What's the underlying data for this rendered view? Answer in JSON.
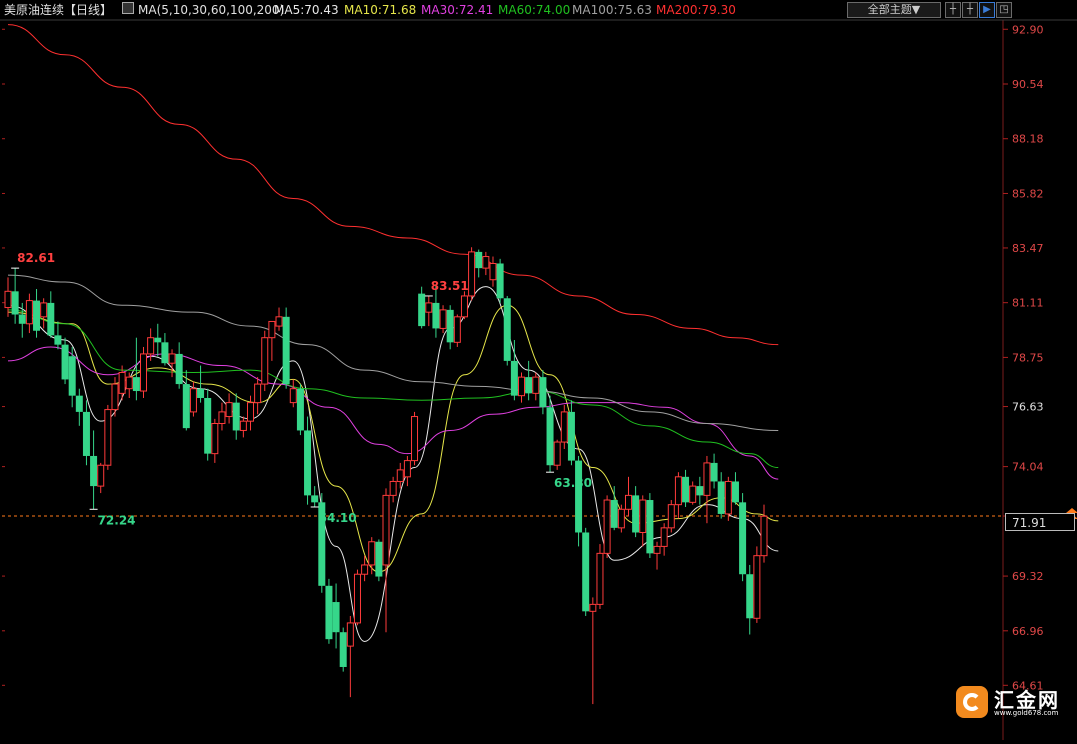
{
  "header": {
    "instrument": "美原油连续",
    "period": "【日线】",
    "ma_label": "MA(5,10,30,60,100,200)",
    "ma5": "MA5:70.43",
    "ma10": "MA10:71.68",
    "ma30": "MA30:72.41",
    "ma60": "MA60:74.00",
    "ma100": "MA100:75.63",
    "ma200": "MA200:79.30",
    "theme_button": "全部主题▼"
  },
  "colors": {
    "up": "#ff3b3b",
    "down": "#36d68a",
    "ma5": "#e8e8e8",
    "ma10": "#e6e64a",
    "ma30": "#e040e0",
    "ma60": "#20c020",
    "ma100": "#a0a0a0",
    "ma200": "#ff3030",
    "axis_text": "#e04848",
    "current_line": "#ff7a1a"
  },
  "icons": [
    "crosshair-icon",
    "zoom-in-icon",
    "layout-icon",
    "expand-icon"
  ],
  "logo": {
    "name": "汇金网",
    "url": "www.gold678.com"
  },
  "chart_data": {
    "type": "candlestick",
    "y_ticks": [
      "92.90",
      "90.54",
      "88.18",
      "85.82",
      "83.47",
      "81.11",
      "78.75",
      "76.63",
      "74.04",
      "71.91",
      "69.32",
      "66.96",
      "64.61"
    ],
    "ylim": [
      63.2,
      93.3
    ],
    "current_price": "71.91",
    "highlighted_tick": "76.63",
    "annotations": [
      {
        "label": "82.61",
        "index": 1,
        "kind": "high"
      },
      {
        "label": "72.24",
        "index": 12,
        "kind": "low"
      },
      {
        "label": "64.10",
        "index": 43,
        "kind": "low"
      },
      {
        "label": "83.51",
        "index": 59,
        "kind": "high"
      },
      {
        "label": "63.80",
        "index": 76,
        "kind": "low"
      }
    ],
    "candles": [
      [
        80.9,
        82.2,
        80.5,
        81.6
      ],
      [
        81.6,
        82.6,
        80.2,
        80.6
      ],
      [
        80.6,
        81.1,
        79.6,
        80.2
      ],
      [
        80.2,
        81.5,
        79.8,
        81.2
      ],
      [
        81.2,
        81.7,
        79.6,
        79.9
      ],
      [
        80.5,
        81.3,
        80.0,
        81.1
      ],
      [
        81.1,
        81.6,
        79.6,
        79.7
      ],
      [
        79.7,
        80.3,
        79.1,
        79.3
      ],
      [
        79.3,
        79.6,
        77.6,
        77.8
      ],
      [
        78.8,
        79.2,
        76.6,
        77.1
      ],
      [
        77.1,
        77.4,
        75.8,
        76.4
      ],
      [
        76.4,
        76.9,
        74.1,
        74.5
      ],
      [
        74.5,
        75.6,
        72.2,
        73.2
      ],
      [
        73.2,
        74.2,
        72.9,
        74.1
      ],
      [
        74.1,
        76.7,
        73.9,
        76.5
      ],
      [
        76.5,
        77.9,
        76.2,
        77.6
      ],
      [
        77.2,
        78.4,
        76.9,
        78.1
      ],
      [
        77.4,
        78.1,
        77.0,
        77.9
      ],
      [
        77.9,
        79.6,
        76.9,
        77.3
      ],
      [
        77.3,
        79.2,
        77.0,
        78.9
      ],
      [
        78.9,
        80.0,
        78.6,
        79.6
      ],
      [
        79.6,
        80.2,
        78.8,
        79.4
      ],
      [
        79.4,
        79.8,
        78.4,
        78.5
      ],
      [
        78.5,
        79.1,
        77.9,
        78.9
      ],
      [
        78.9,
        79.4,
        77.4,
        77.6
      ],
      [
        77.6,
        78.2,
        75.6,
        75.7
      ],
      [
        76.4,
        77.7,
        76.2,
        77.4
      ],
      [
        77.4,
        78.4,
        76.8,
        77.0
      ],
      [
        77.0,
        77.4,
        74.3,
        74.6
      ],
      [
        74.6,
        76.1,
        74.2,
        75.9
      ],
      [
        75.9,
        76.8,
        75.6,
        76.4
      ],
      [
        76.2,
        77.2,
        75.9,
        76.8
      ],
      [
        76.8,
        77.2,
        75.2,
        75.6
      ],
      [
        75.6,
        76.2,
        75.3,
        76.0
      ],
      [
        76.0,
        77.1,
        75.6,
        76.8
      ],
      [
        76.8,
        77.9,
        76.3,
        77.6
      ],
      [
        77.6,
        79.9,
        77.3,
        79.6
      ],
      [
        79.6,
        80.3,
        78.6,
        80.3
      ],
      [
        80.1,
        80.9,
        79.9,
        80.5
      ],
      [
        80.5,
        80.9,
        77.4,
        77.6
      ],
      [
        76.8,
        77.8,
        76.6,
        77.4
      ],
      [
        77.4,
        77.6,
        75.4,
        75.6
      ],
      [
        75.6,
        76.2,
        72.4,
        72.8
      ],
      [
        72.8,
        73.2,
        72.3,
        72.5
      ],
      [
        72.5,
        72.9,
        68.6,
        68.9
      ],
      [
        68.9,
        69.2,
        66.4,
        66.6
      ],
      [
        68.2,
        69.0,
        66.2,
        66.9
      ],
      [
        66.9,
        67.1,
        65.2,
        65.4
      ],
      [
        66.3,
        67.6,
        64.1,
        67.3
      ],
      [
        67.3,
        69.6,
        67.2,
        69.4
      ],
      [
        69.4,
        70.2,
        69.1,
        69.8
      ],
      [
        69.8,
        71.0,
        69.4,
        70.8
      ],
      [
        70.8,
        70.9,
        69.1,
        69.3
      ],
      [
        69.8,
        73.1,
        66.9,
        72.8
      ],
      [
        72.8,
        73.6,
        72.5,
        73.4
      ],
      [
        73.4,
        74.2,
        73.1,
        73.9
      ],
      [
        73.6,
        74.5,
        73.2,
        74.3
      ],
      [
        74.3,
        76.4,
        74.1,
        76.2
      ],
      [
        81.5,
        81.8,
        80.0,
        80.1
      ],
      [
        80.7,
        81.4,
        80.1,
        81.1
      ],
      [
        81.1,
        81.9,
        79.6,
        80.0
      ],
      [
        80.0,
        81.0,
        79.8,
        80.8
      ],
      [
        80.8,
        81.0,
        79.1,
        79.4
      ],
      [
        79.4,
        80.6,
        79.2,
        80.5
      ],
      [
        80.5,
        81.6,
        80.4,
        81.4
      ],
      [
        81.4,
        83.5,
        81.2,
        83.3
      ],
      [
        83.3,
        83.4,
        82.2,
        82.6
      ],
      [
        82.6,
        83.3,
        82.3,
        83.1
      ],
      [
        82.1,
        83.1,
        81.8,
        82.8
      ],
      [
        82.8,
        83.0,
        81.1,
        81.3
      ],
      [
        81.3,
        81.4,
        78.4,
        78.6
      ],
      [
        78.6,
        79.5,
        76.9,
        77.1
      ],
      [
        77.1,
        78.1,
        76.8,
        77.9
      ],
      [
        77.9,
        78.6,
        76.9,
        77.2
      ],
      [
        77.2,
        78.1,
        76.9,
        77.9
      ],
      [
        77.9,
        78.2,
        76.3,
        76.6
      ],
      [
        76.6,
        77.1,
        73.8,
        74.1
      ],
      [
        74.1,
        75.2,
        73.9,
        75.1
      ],
      [
        75.1,
        76.7,
        74.8,
        76.4
      ],
      [
        76.4,
        76.9,
        74.1,
        74.3
      ],
      [
        74.3,
        74.5,
        70.6,
        71.2
      ],
      [
        71.2,
        71.4,
        67.6,
        67.8
      ],
      [
        67.8,
        68.4,
        63.8,
        68.1
      ],
      [
        68.1,
        70.7,
        67.9,
        70.3
      ],
      [
        70.3,
        72.8,
        70.1,
        72.6
      ],
      [
        72.6,
        73.2,
        71.3,
        71.4
      ],
      [
        71.4,
        72.4,
        71.2,
        72.2
      ],
      [
        72.2,
        73.6,
        71.9,
        72.8
      ],
      [
        72.8,
        73.2,
        71.0,
        71.2
      ],
      [
        71.2,
        72.8,
        70.6,
        72.6
      ],
      [
        72.6,
        72.9,
        70.1,
        70.3
      ],
      [
        70.3,
        70.8,
        69.6,
        70.6
      ],
      [
        70.6,
        71.6,
        70.2,
        71.4
      ],
      [
        71.4,
        72.6,
        71.2,
        72.4
      ],
      [
        72.4,
        73.8,
        71.8,
        73.6
      ],
      [
        73.6,
        73.9,
        72.3,
        72.5
      ],
      [
        72.5,
        73.4,
        72.4,
        73.2
      ],
      [
        73.2,
        73.6,
        72.4,
        72.8
      ],
      [
        72.8,
        74.5,
        71.6,
        74.2
      ],
      [
        74.2,
        74.6,
        73.1,
        73.4
      ],
      [
        73.4,
        73.8,
        71.8,
        72.0
      ],
      [
        72.0,
        73.6,
        71.7,
        73.4
      ],
      [
        73.4,
        73.8,
        72.4,
        72.5
      ],
      [
        72.5,
        72.9,
        69.1,
        69.4
      ],
      [
        69.4,
        69.8,
        66.8,
        67.5
      ],
      [
        67.5,
        70.6,
        67.3,
        70.2
      ],
      [
        70.2,
        72.4,
        69.9,
        71.9
      ]
    ],
    "ma": [
      {
        "name": "MA5",
        "color": "#e8e8e8",
        "points": [
          [
            0,
            81.0
          ],
          [
            8,
            79.5
          ],
          [
            13,
            76.0
          ],
          [
            20,
            78.8
          ],
          [
            27,
            77.4
          ],
          [
            34,
            76.1
          ],
          [
            40,
            78.6
          ],
          [
            46,
            70.6
          ],
          [
            50,
            66.5
          ],
          [
            57,
            74.0
          ],
          [
            62,
            80.0
          ],
          [
            67,
            81.8
          ],
          [
            73,
            78.2
          ],
          [
            80,
            74.8
          ],
          [
            85,
            70.0
          ],
          [
            92,
            71.0
          ],
          [
            98,
            72.4
          ],
          [
            103,
            71.8
          ],
          [
            108,
            70.4
          ]
        ]
      },
      {
        "name": "MA10",
        "color": "#e6e64a",
        "points": [
          [
            0,
            80.7
          ],
          [
            9,
            80.2
          ],
          [
            14,
            77.6
          ],
          [
            21,
            78.3
          ],
          [
            28,
            77.6
          ],
          [
            35,
            76.8
          ],
          [
            40,
            77.8
          ],
          [
            46,
            73.2
          ],
          [
            52,
            69.5
          ],
          [
            58,
            72.0
          ],
          [
            64,
            78.0
          ],
          [
            70,
            81.0
          ],
          [
            76,
            78.0
          ],
          [
            82,
            74.0
          ],
          [
            88,
            71.6
          ],
          [
            94,
            71.8
          ],
          [
            100,
            72.7
          ],
          [
            105,
            72.0
          ],
          [
            108,
            71.7
          ]
        ]
      },
      {
        "name": "MA30",
        "color": "#e040e0",
        "points": [
          [
            0,
            78.6
          ],
          [
            6,
            79.2
          ],
          [
            14,
            78.0
          ],
          [
            22,
            78.9
          ],
          [
            30,
            78.4
          ],
          [
            38,
            77.6
          ],
          [
            45,
            76.6
          ],
          [
            52,
            75.0
          ],
          [
            56,
            74.6
          ],
          [
            62,
            75.6
          ],
          [
            68,
            76.3
          ],
          [
            74,
            76.6
          ],
          [
            80,
            76.8
          ],
          [
            86,
            76.8
          ],
          [
            92,
            76.6
          ],
          [
            98,
            75.9
          ],
          [
            104,
            74.5
          ],
          [
            108,
            73.5
          ]
        ]
      },
      {
        "name": "MA60",
        "color": "#20c020",
        "points": [
          [
            0,
            80.8
          ],
          [
            8,
            80.2
          ],
          [
            16,
            78.2
          ],
          [
            26,
            78.1
          ],
          [
            34,
            78.2
          ],
          [
            42,
            77.4
          ],
          [
            50,
            77.0
          ],
          [
            58,
            76.9
          ],
          [
            66,
            77.0
          ],
          [
            74,
            77.3
          ],
          [
            82,
            76.7
          ],
          [
            90,
            75.8
          ],
          [
            98,
            75.1
          ],
          [
            104,
            74.6
          ],
          [
            108,
            74.0
          ]
        ]
      },
      {
        "name": "MA100",
        "color": "#a0a0a0",
        "points": [
          [
            0,
            82.3
          ],
          [
            8,
            82.0
          ],
          [
            16,
            81.0
          ],
          [
            26,
            80.7
          ],
          [
            34,
            80.1
          ],
          [
            42,
            79.3
          ],
          [
            50,
            78.2
          ],
          [
            58,
            77.7
          ],
          [
            66,
            77.5
          ],
          [
            74,
            77.3
          ],
          [
            82,
            77.0
          ],
          [
            90,
            76.4
          ],
          [
            98,
            75.9
          ],
          [
            108,
            75.6
          ]
        ]
      },
      {
        "name": "MA200",
        "color": "#ff3030",
        "points": [
          [
            0,
            93.1
          ],
          [
            8,
            91.8
          ],
          [
            16,
            90.4
          ],
          [
            24,
            88.8
          ],
          [
            32,
            87.3
          ],
          [
            40,
            85.6
          ],
          [
            48,
            84.4
          ],
          [
            56,
            83.9
          ],
          [
            64,
            83.2
          ],
          [
            72,
            82.3
          ],
          [
            80,
            81.4
          ],
          [
            88,
            80.6
          ],
          [
            96,
            80.0
          ],
          [
            102,
            79.6
          ],
          [
            108,
            79.3
          ]
        ]
      }
    ]
  }
}
